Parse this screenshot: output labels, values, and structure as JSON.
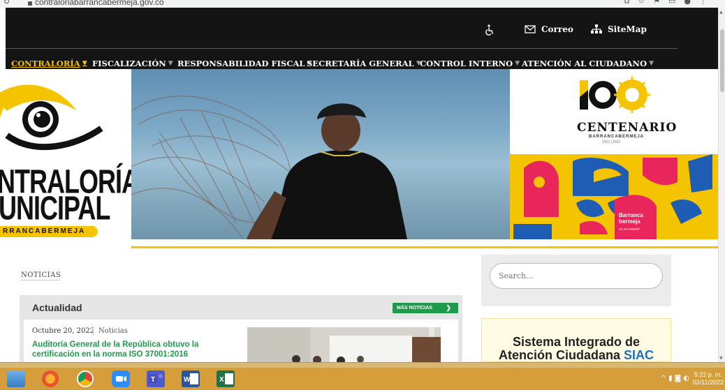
{
  "browser": {
    "url": "contraloriabarrancabermeja.gov.co"
  },
  "header": {
    "correo_label": "Correo",
    "sitemap_label": "SiteMap"
  },
  "nav": {
    "items": [
      {
        "label": "CONTRALORÍA"
      },
      {
        "label": "FISCALIZACIÓN"
      },
      {
        "label": "RESPONSABILIDAD FISCAL"
      },
      {
        "label": "SECRETARÍA GENERAL"
      },
      {
        "label": "CONTROL INTERNO"
      },
      {
        "label": "ATENCIÓN AL CIUDADANO"
      }
    ]
  },
  "banner": {
    "logo_line1": "NTRALORÍA",
    "logo_line2": "UNICIPAL",
    "logo_strip": "RRANCABERMEJA",
    "centenario": "CENTENARIO",
    "centenario_city": "BARRANCABERMEJA",
    "centenario_years": "1922 | 2022",
    "barranca_line1": "Barranca",
    "barranca_line2": "bermeja",
    "barranca_sub": "en el corazón"
  },
  "noticias": {
    "section_label": "NOTICIAS",
    "panel_title": "Actualidad",
    "more_button": "MÁS NOTICIAS",
    "item": {
      "date": "Octubre 20, 2022",
      "category": "Noticias",
      "title": "Auditoría General de la República obtuvo la certificación en la norma ISO 37001:2016"
    }
  },
  "sidebar": {
    "search_placeholder": "Search...",
    "siac_line1": "Sistema Integrado de",
    "siac_line2": "Atención Ciudadana",
    "siac_brand": "SIAC"
  },
  "taskbar": {
    "time": "5:22 p. m.",
    "date": "02/11/2022"
  },
  "colors": {
    "accent_yellow": "#f5c400",
    "nav_bg": "#141414",
    "green": "#1e9b4a",
    "siac_blue": "#1f6fb5"
  }
}
